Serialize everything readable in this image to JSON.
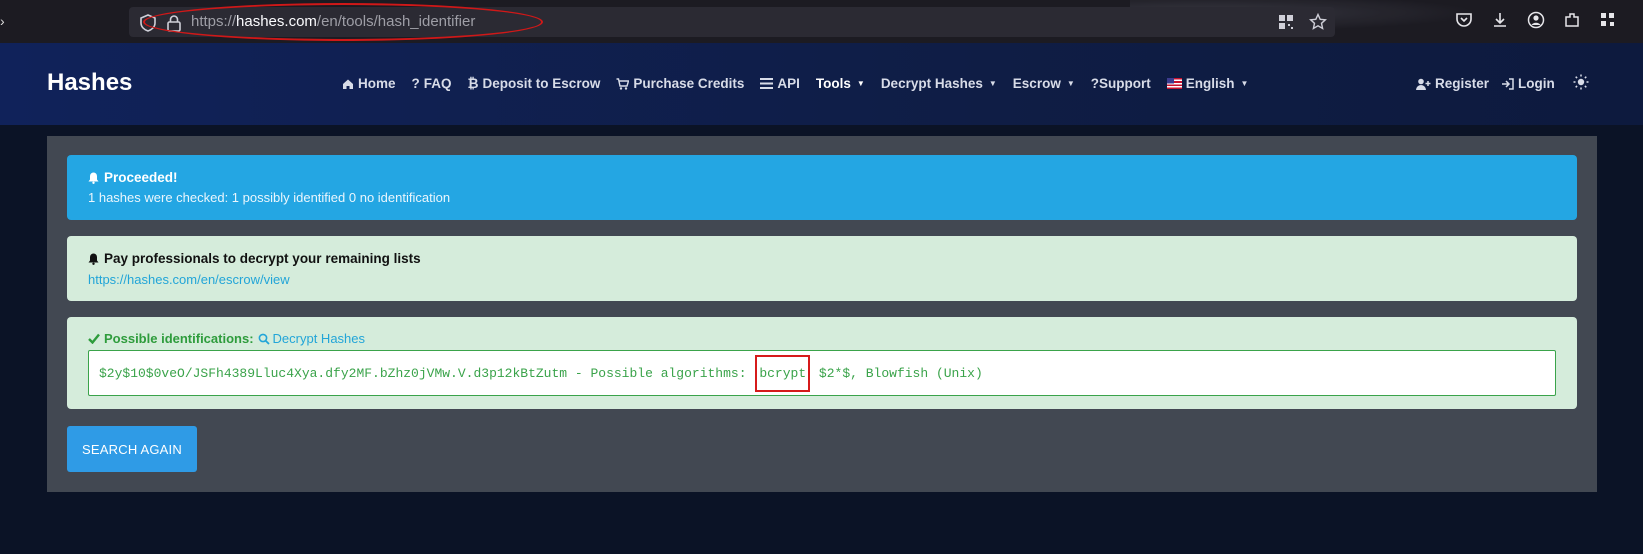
{
  "browser": {
    "url_prefix": "https://",
    "url_host": "hashes.com",
    "url_path": "/en/tools/hash_identifier"
  },
  "site": {
    "brand": "Hashes",
    "nav": [
      {
        "label": "Home",
        "icon": "home-icon"
      },
      {
        "label": "FAQ",
        "icon": "question-icon"
      },
      {
        "label": "Deposit to Escrow",
        "icon": "bitcoin-icon"
      },
      {
        "label": "Purchase Credits",
        "icon": "cart-icon"
      },
      {
        "label": "API",
        "icon": "api-icon"
      },
      {
        "label": "Tools",
        "dropdown": true
      },
      {
        "label": "Decrypt Hashes",
        "dropdown": true
      },
      {
        "label": "Escrow",
        "dropdown": true
      },
      {
        "label": "?Support"
      },
      {
        "label": "English",
        "icon": "us-flag-icon",
        "dropdown": true
      }
    ],
    "register": "Register",
    "login": "Login"
  },
  "alerts": {
    "info_title": "Proceeded!",
    "info_text": "1 hashes were checked: 1 possibly identified 0 no identification",
    "promo_title": "Pay professionals to decrypt your remaining lists",
    "promo_link": "https://hashes.com/en/escrow/view"
  },
  "result": {
    "heading": "Possible identifications:",
    "decrypt_link": "Decrypt Hashes",
    "hash": "$2y$10$0veO/JSFh4389Lluc4Xya.dfy2MF.bZhz0jVMw.V.d3p12kBtZutm",
    "separator": " - Possible algorithms: ",
    "algorithm_highlight": "bcrypt",
    "algorithm_rest": " $2*$, Blowfish (Unix)"
  },
  "button": {
    "search_again": "SEARCH AGAIN"
  },
  "colors": {
    "info_bg": "#24a6e3",
    "success_bg": "#d5ecdb",
    "result_text": "#3aa34a",
    "annotation_red": "#d61b1b"
  }
}
